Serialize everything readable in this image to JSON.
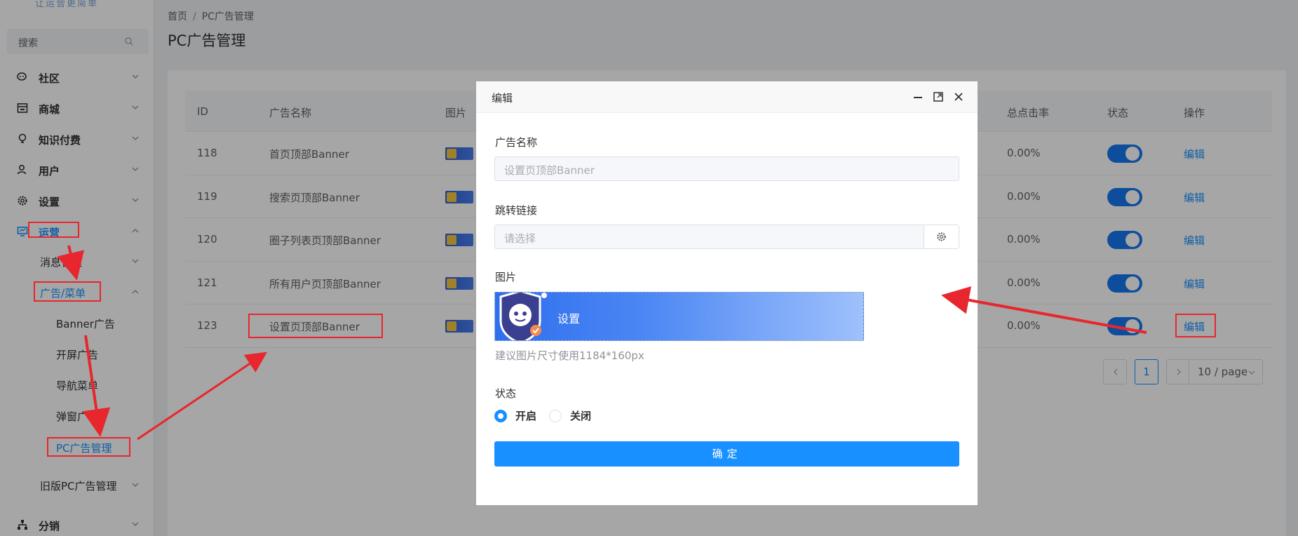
{
  "sidebar": {
    "logo_text": "让运营更简单",
    "search_placeholder": "搜索",
    "menu": [
      {
        "label": "社区",
        "icon": "chat-icon"
      },
      {
        "label": "商城",
        "icon": "store-icon"
      },
      {
        "label": "知识付费",
        "icon": "lightbulb-icon"
      },
      {
        "label": "用户",
        "icon": "user-icon"
      },
      {
        "label": "设置",
        "icon": "gear-icon"
      },
      {
        "label": "运营",
        "icon": "monitor-icon"
      }
    ],
    "operations_sub": {
      "message": "消息管理",
      "ads_menu": "广告/菜单",
      "ads_children": [
        "Banner广告",
        "开屏广告",
        "导航菜单",
        "弹窗广告",
        "PC广告管理"
      ],
      "legacy_pc": "旧版PC广告管理"
    },
    "distribution": "分销"
  },
  "header": {
    "breadcrumb": [
      "首页",
      "PC广告管理"
    ],
    "title": "PC广告管理"
  },
  "table": {
    "columns": [
      "ID",
      "广告名称",
      "图片",
      "总点击率",
      "状态",
      "操作"
    ],
    "rows": [
      {
        "id": "118",
        "name": "首页顶部Banner",
        "rate": "0.00%",
        "action": "编辑"
      },
      {
        "id": "119",
        "name": "搜索页顶部Banner",
        "rate": "0.00%",
        "action": "编辑"
      },
      {
        "id": "120",
        "name": "圈子列表页顶部Banner",
        "rate": "0.00%",
        "action": "编辑"
      },
      {
        "id": "121",
        "name": "所有用户页顶部Banner",
        "rate": "0.00%",
        "action": "编辑"
      },
      {
        "id": "123",
        "name": "设置页顶部Banner",
        "rate": "0.00%",
        "action": "编辑"
      }
    ]
  },
  "pagination": {
    "current": "1",
    "page_size": "10 / page"
  },
  "dialog": {
    "title": "编辑",
    "ad_name_label": "广告名称",
    "ad_name_value": "设置页顶部Banner",
    "link_label": "跳转链接",
    "link_placeholder": "请选择",
    "image_label": "图片",
    "banner_text": "设置",
    "image_hint": "建议图片尺寸使用1184*160px",
    "status_label": "状态",
    "status_on": "开启",
    "status_off": "关闭",
    "confirm": "确定"
  },
  "colors": {
    "primary": "#1890ff",
    "annotation_red": "#e8262d"
  }
}
